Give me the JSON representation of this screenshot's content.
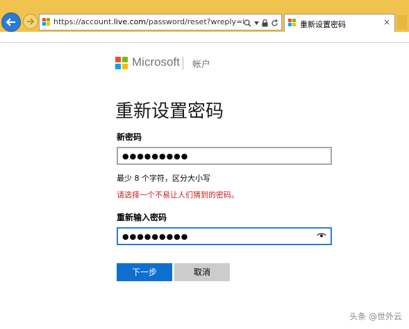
{
  "browser": {
    "url_prefix": "https://account.",
    "url_domain": "live.com",
    "url_rest": "/password/reset?wreply=https://log",
    "tab_title": "重新设置密码",
    "tab_close": "×",
    "search_icon": "search-icon",
    "lock_icon": "lock-icon",
    "refresh_icon": "refresh-icon"
  },
  "header": {
    "brand": "Microsoft",
    "subtitle": "帐户"
  },
  "form": {
    "title": "重新设置密码",
    "new_password_label": "新密码",
    "new_password_value": "●●●●●●●●●",
    "hint": "最少 8 个字符，区分大小写",
    "error": "请选择一个不易让人们猜到的密码。",
    "confirm_label": "重新输入密码",
    "confirm_value": "●●●●●●●●●",
    "next_label": "下一步",
    "cancel_label": "取消"
  },
  "watermark": "头条 @世外云",
  "colors": {
    "chrome": "#f0c24e",
    "accent": "#0f6fd1",
    "error": "#c81d1d",
    "ms_red": "#f25022",
    "ms_green": "#7fba00",
    "ms_blue": "#00a4ef",
    "ms_yellow": "#ffb900"
  }
}
